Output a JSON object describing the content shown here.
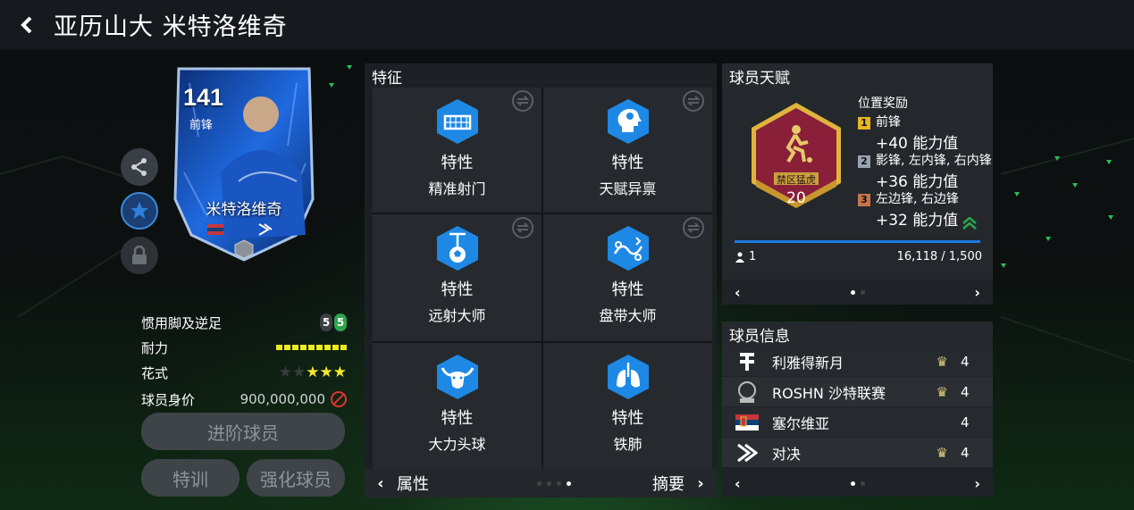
{
  "header": {
    "title": "亚历山大 米特洛维奇",
    "back_icon": "chevron-left-icon"
  },
  "card": {
    "rating": "141",
    "position": "前锋",
    "name": "米特洛维奇"
  },
  "side_buttons": [
    "share-icon",
    "star-icon",
    "lock-icon"
  ],
  "attributes": {
    "weak_foot_label": "惯用脚及逆足",
    "weak_foot_left": "5",
    "weak_foot_right": "5",
    "stamina_label": "耐力",
    "stamina_level": 1.0,
    "skill_label": "花式",
    "skill_stars": 3,
    "skill_stars_max": 5,
    "value_label": "球员身价",
    "value": "900,000,000"
  },
  "buttons": {
    "upgrade": "进阶球员",
    "training": "特训",
    "enhance": "强化球员"
  },
  "traits": {
    "title": "特征",
    "items": [
      {
        "kind": "特性",
        "name": "精准射门",
        "icon": "goal-net-icon"
      },
      {
        "kind": "特性",
        "name": "天赋异禀",
        "icon": "head-brain-icon"
      },
      {
        "kind": "特性",
        "name": "远射大师",
        "icon": "ball-shot-icon"
      },
      {
        "kind": "特性",
        "name": "盘带大师",
        "icon": "dribble-icon"
      },
      {
        "kind": "特性",
        "name": "大力头球",
        "icon": "bull-head-icon"
      },
      {
        "kind": "特性",
        "name": "铁肺",
        "icon": "lungs-icon"
      }
    ],
    "footer_left": "属性",
    "footer_right": "摘要"
  },
  "talent": {
    "title": "球员天赋",
    "badge_name": "禁区猛虎",
    "badge_level": "20",
    "bonus_title": "位置奖励",
    "bonuses": [
      {
        "idx": "1",
        "positions": "前锋",
        "points": "+40 能力值",
        "color": "#e6b422"
      },
      {
        "idx": "2",
        "positions": "影锋, 左内锋, 右内锋",
        "points": "+36 能力值",
        "color": "#9aa3b2"
      },
      {
        "idx": "3",
        "positions": "左边锋, 右边锋",
        "points": "+32 能力值",
        "color": "#c8744a"
      }
    ],
    "count": "1",
    "progress": "16,118 / 1,500"
  },
  "info": {
    "title": "球员信息",
    "rows": [
      {
        "label": "利雅得新月",
        "icon": "club-crest-icon",
        "level": "4",
        "crown": true
      },
      {
        "label": "ROSHN 沙特联赛",
        "icon": "league-logo-icon",
        "level": "4",
        "crown": true
      },
      {
        "label": "塞尔维亚",
        "icon": "serbia-flag-icon",
        "level": "4",
        "crown": false
      },
      {
        "label": "对决",
        "icon": "versus-icon",
        "level": "4",
        "crown": true
      }
    ]
  }
}
